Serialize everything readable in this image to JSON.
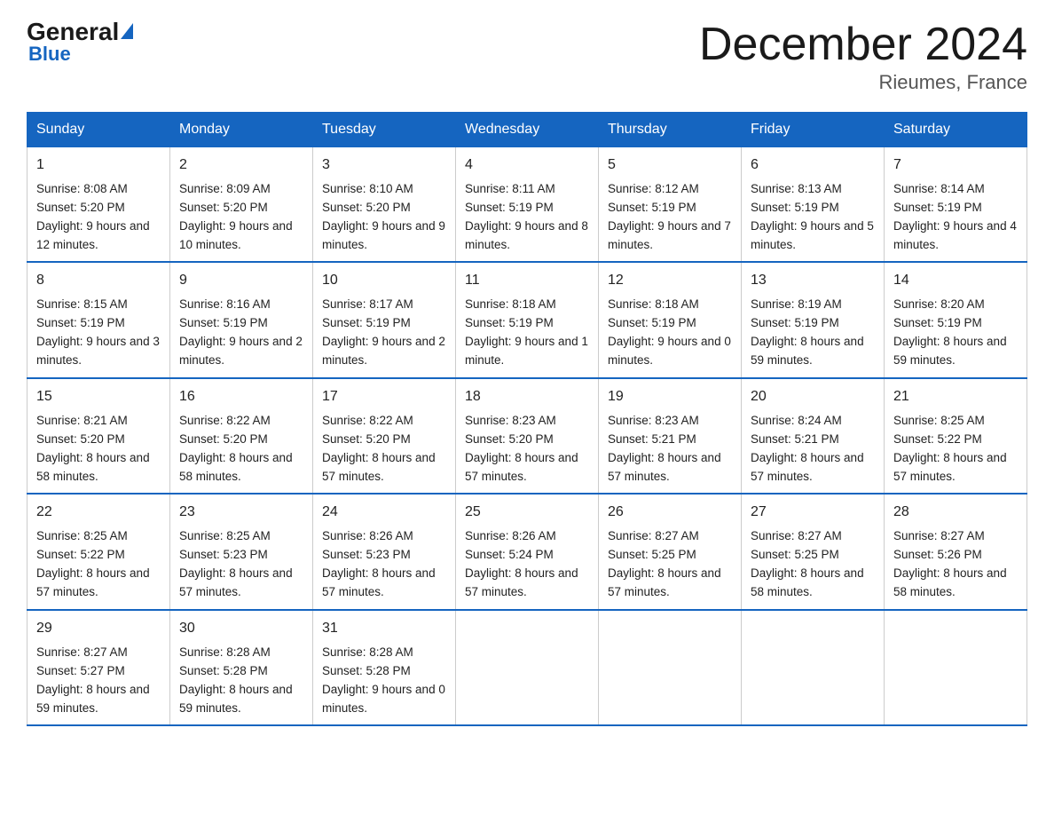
{
  "header": {
    "logo_general": "General",
    "logo_blue": "Blue",
    "title": "December 2024",
    "subtitle": "Rieumes, France"
  },
  "days_of_week": [
    "Sunday",
    "Monday",
    "Tuesday",
    "Wednesday",
    "Thursday",
    "Friday",
    "Saturday"
  ],
  "weeks": [
    [
      {
        "day": "1",
        "sunrise": "Sunrise: 8:08 AM",
        "sunset": "Sunset: 5:20 PM",
        "daylight": "Daylight: 9 hours and 12 minutes."
      },
      {
        "day": "2",
        "sunrise": "Sunrise: 8:09 AM",
        "sunset": "Sunset: 5:20 PM",
        "daylight": "Daylight: 9 hours and 10 minutes."
      },
      {
        "day": "3",
        "sunrise": "Sunrise: 8:10 AM",
        "sunset": "Sunset: 5:20 PM",
        "daylight": "Daylight: 9 hours and 9 minutes."
      },
      {
        "day": "4",
        "sunrise": "Sunrise: 8:11 AM",
        "sunset": "Sunset: 5:19 PM",
        "daylight": "Daylight: 9 hours and 8 minutes."
      },
      {
        "day": "5",
        "sunrise": "Sunrise: 8:12 AM",
        "sunset": "Sunset: 5:19 PM",
        "daylight": "Daylight: 9 hours and 7 minutes."
      },
      {
        "day": "6",
        "sunrise": "Sunrise: 8:13 AM",
        "sunset": "Sunset: 5:19 PM",
        "daylight": "Daylight: 9 hours and 5 minutes."
      },
      {
        "day": "7",
        "sunrise": "Sunrise: 8:14 AM",
        "sunset": "Sunset: 5:19 PM",
        "daylight": "Daylight: 9 hours and 4 minutes."
      }
    ],
    [
      {
        "day": "8",
        "sunrise": "Sunrise: 8:15 AM",
        "sunset": "Sunset: 5:19 PM",
        "daylight": "Daylight: 9 hours and 3 minutes."
      },
      {
        "day": "9",
        "sunrise": "Sunrise: 8:16 AM",
        "sunset": "Sunset: 5:19 PM",
        "daylight": "Daylight: 9 hours and 2 minutes."
      },
      {
        "day": "10",
        "sunrise": "Sunrise: 8:17 AM",
        "sunset": "Sunset: 5:19 PM",
        "daylight": "Daylight: 9 hours and 2 minutes."
      },
      {
        "day": "11",
        "sunrise": "Sunrise: 8:18 AM",
        "sunset": "Sunset: 5:19 PM",
        "daylight": "Daylight: 9 hours and 1 minute."
      },
      {
        "day": "12",
        "sunrise": "Sunrise: 8:18 AM",
        "sunset": "Sunset: 5:19 PM",
        "daylight": "Daylight: 9 hours and 0 minutes."
      },
      {
        "day": "13",
        "sunrise": "Sunrise: 8:19 AM",
        "sunset": "Sunset: 5:19 PM",
        "daylight": "Daylight: 8 hours and 59 minutes."
      },
      {
        "day": "14",
        "sunrise": "Sunrise: 8:20 AM",
        "sunset": "Sunset: 5:19 PM",
        "daylight": "Daylight: 8 hours and 59 minutes."
      }
    ],
    [
      {
        "day": "15",
        "sunrise": "Sunrise: 8:21 AM",
        "sunset": "Sunset: 5:20 PM",
        "daylight": "Daylight: 8 hours and 58 minutes."
      },
      {
        "day": "16",
        "sunrise": "Sunrise: 8:22 AM",
        "sunset": "Sunset: 5:20 PM",
        "daylight": "Daylight: 8 hours and 58 minutes."
      },
      {
        "day": "17",
        "sunrise": "Sunrise: 8:22 AM",
        "sunset": "Sunset: 5:20 PM",
        "daylight": "Daylight: 8 hours and 57 minutes."
      },
      {
        "day": "18",
        "sunrise": "Sunrise: 8:23 AM",
        "sunset": "Sunset: 5:20 PM",
        "daylight": "Daylight: 8 hours and 57 minutes."
      },
      {
        "day": "19",
        "sunrise": "Sunrise: 8:23 AM",
        "sunset": "Sunset: 5:21 PM",
        "daylight": "Daylight: 8 hours and 57 minutes."
      },
      {
        "day": "20",
        "sunrise": "Sunrise: 8:24 AM",
        "sunset": "Sunset: 5:21 PM",
        "daylight": "Daylight: 8 hours and 57 minutes."
      },
      {
        "day": "21",
        "sunrise": "Sunrise: 8:25 AM",
        "sunset": "Sunset: 5:22 PM",
        "daylight": "Daylight: 8 hours and 57 minutes."
      }
    ],
    [
      {
        "day": "22",
        "sunrise": "Sunrise: 8:25 AM",
        "sunset": "Sunset: 5:22 PM",
        "daylight": "Daylight: 8 hours and 57 minutes."
      },
      {
        "day": "23",
        "sunrise": "Sunrise: 8:25 AM",
        "sunset": "Sunset: 5:23 PM",
        "daylight": "Daylight: 8 hours and 57 minutes."
      },
      {
        "day": "24",
        "sunrise": "Sunrise: 8:26 AM",
        "sunset": "Sunset: 5:23 PM",
        "daylight": "Daylight: 8 hours and 57 minutes."
      },
      {
        "day": "25",
        "sunrise": "Sunrise: 8:26 AM",
        "sunset": "Sunset: 5:24 PM",
        "daylight": "Daylight: 8 hours and 57 minutes."
      },
      {
        "day": "26",
        "sunrise": "Sunrise: 8:27 AM",
        "sunset": "Sunset: 5:25 PM",
        "daylight": "Daylight: 8 hours and 57 minutes."
      },
      {
        "day": "27",
        "sunrise": "Sunrise: 8:27 AM",
        "sunset": "Sunset: 5:25 PM",
        "daylight": "Daylight: 8 hours and 58 minutes."
      },
      {
        "day": "28",
        "sunrise": "Sunrise: 8:27 AM",
        "sunset": "Sunset: 5:26 PM",
        "daylight": "Daylight: 8 hours and 58 minutes."
      }
    ],
    [
      {
        "day": "29",
        "sunrise": "Sunrise: 8:27 AM",
        "sunset": "Sunset: 5:27 PM",
        "daylight": "Daylight: 8 hours and 59 minutes."
      },
      {
        "day": "30",
        "sunrise": "Sunrise: 8:28 AM",
        "sunset": "Sunset: 5:28 PM",
        "daylight": "Daylight: 8 hours and 59 minutes."
      },
      {
        "day": "31",
        "sunrise": "Sunrise: 8:28 AM",
        "sunset": "Sunset: 5:28 PM",
        "daylight": "Daylight: 9 hours and 0 minutes."
      },
      {
        "day": "",
        "sunrise": "",
        "sunset": "",
        "daylight": ""
      },
      {
        "day": "",
        "sunrise": "",
        "sunset": "",
        "daylight": ""
      },
      {
        "day": "",
        "sunrise": "",
        "sunset": "",
        "daylight": ""
      },
      {
        "day": "",
        "sunrise": "",
        "sunset": "",
        "daylight": ""
      }
    ]
  ]
}
